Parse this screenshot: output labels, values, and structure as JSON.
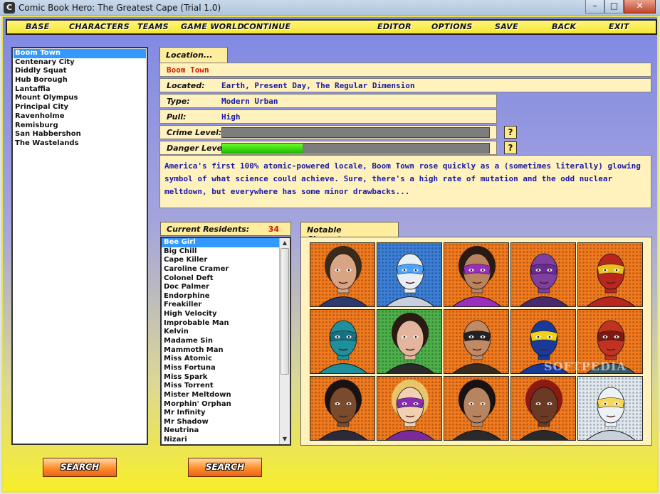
{
  "window": {
    "title": "Comic Book Hero: The Greatest Cape (Trial 1.0)",
    "app_icon": "C"
  },
  "menu": {
    "base": "BASE",
    "characters": "CHARACTERS",
    "teams": "TEAMS",
    "game_world": "GAME WORLD",
    "continue": "CONTINUE",
    "editor": "EDITOR",
    "options": "OPTIONS",
    "save": "SAVE",
    "back": "BACK",
    "exit": "EXIT"
  },
  "locations": [
    "Boom Town",
    "Centenary City",
    "Diddly Squat",
    "Hub Borough",
    "Lantaffia",
    "Mount Olympus",
    "Principal City",
    "Ravenholme",
    "Remisburg",
    "San Habbershon",
    "The Wastelands"
  ],
  "selected_location": "Boom Town",
  "location_panel": {
    "tab": "Location...",
    "name": "Boom Town",
    "located_label": "Located:",
    "located": "Earth, Present Day, The Regular Dimension",
    "type_label": "Type:",
    "type": "Modern Urban",
    "pull_label": "Pull:",
    "pull": "High",
    "crime_label": "Crime Level:",
    "crime_level": 0.0,
    "danger_label": "Danger Level:",
    "danger_level": 0.3,
    "help": "?",
    "description": "America's first 100% atomic-powered locale, Boom Town rose quickly as a (sometimes literally) glowing symbol of what science could achieve. Sure, there's a high rate of mutation and the odd nuclear meltdown, but everywhere has some minor drawbacks..."
  },
  "residents": {
    "label": "Current Residents:",
    "count": "34",
    "selected": "Bee Girl",
    "items": [
      "Bee Girl",
      "Big Chill",
      "Cape Killer",
      "Caroline Cramer",
      "Colonel Deft",
      "Doc Palmer",
      "Endorphine",
      "Freakiller",
      "High Velocity",
      "Improbable Man",
      "Kelvin",
      "Madame Sin",
      "Mammoth Man",
      "Miss Atomic",
      "Miss Fortuna",
      "Miss Spark",
      "Miss Torrent",
      "Mister Meltdown",
      "Morphin' Orphan",
      "Mr Infinity",
      "Mr Shadow",
      "Neutrina",
      "Nizari"
    ]
  },
  "notable": {
    "label": "Notable Characters...",
    "portraits": [
      {
        "bg": "#f27a1e",
        "skin": "#d9a483",
        "hair": "#3a2a1a",
        "mask": "",
        "suit": "#2b3b70"
      },
      {
        "bg": "#3c7fd6",
        "skin": "#e8eef5",
        "hair": "",
        "mask": "#4aa3ff",
        "suit": "#c7d0dc"
      },
      {
        "bg": "#f27a1e",
        "skin": "#b9845d",
        "hair": "#2a1a12",
        "mask": "#9a2fbd",
        "suit": "#9a2fbd"
      },
      {
        "bg": "#f27a1e",
        "skin": "#7e3fa0",
        "hair": "",
        "mask": "#6a2a8e",
        "suit": "#4a2a6e"
      },
      {
        "bg": "#f27a1e",
        "skin": "#b8261d",
        "hair": "",
        "mask": "#e8c11a",
        "suit": "#b8261d"
      },
      {
        "bg": "#f27a1e",
        "skin": "#1f8f9c",
        "hair": "",
        "mask": "#1a6f80",
        "suit": "#1f8f9c"
      },
      {
        "bg": "#4db04a",
        "skin": "#e2b59c",
        "hair": "#2a1a12",
        "mask": "",
        "suit": "#2a2a2a"
      },
      {
        "bg": "#f27a1e",
        "skin": "#c08a66",
        "hair": "",
        "mask": "#222222",
        "suit": "#3a2b20"
      },
      {
        "bg": "#f27a1e",
        "skin": "#1a3a9a",
        "hair": "",
        "mask": "#f1d21a",
        "suit": "#1a3a9a"
      },
      {
        "bg": "#f27a1e",
        "skin": "#c23220",
        "hair": "",
        "mask": "#7a1a12",
        "suit": "#3a5a66"
      },
      {
        "bg": "#f27a1e",
        "skin": "#7a4a2c",
        "hair": "#1a1212",
        "mask": "",
        "suit": "#2a2a3a"
      },
      {
        "bg": "#f27a1e",
        "skin": "#f0d2b2",
        "hair": "#e8c46a",
        "mask": "#8a2ab0",
        "suit": "#7a2a9a"
      },
      {
        "bg": "#f27a1e",
        "skin": "#b88460",
        "hair": "#1a1212",
        "mask": "",
        "suit": "#2a2a2a"
      },
      {
        "bg": "#f27a1e",
        "skin": "#6a3a24",
        "hair": "#8a1a12",
        "mask": "",
        "suit": "#2a2a2a"
      },
      {
        "bg": "#dfe7ef",
        "skin": "#eef2f6",
        "hair": "",
        "mask": "#f5d85a",
        "suit": "#c7d0dc"
      }
    ]
  },
  "buttons": {
    "search_1": "SEARCH",
    "search_2": "SEARCH"
  },
  "watermark": "SOFTPEDIA",
  "colors": {
    "accent_yellow": "#f5e534",
    "selection": "#3399ff",
    "value_text": "#1a1aa8",
    "count_red": "#d21b00"
  }
}
